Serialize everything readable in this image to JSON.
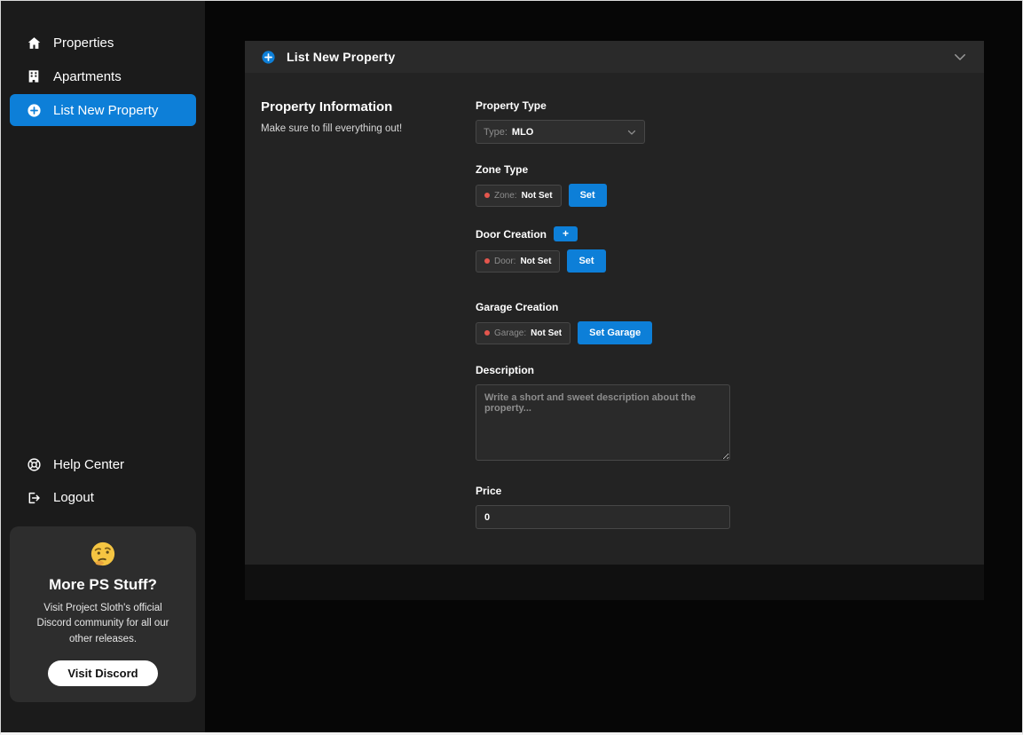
{
  "sidebar": {
    "nav": [
      {
        "label": "Properties",
        "icon": "home-icon",
        "active": false
      },
      {
        "label": "Apartments",
        "icon": "apartments-icon",
        "active": false
      },
      {
        "label": "List New Property",
        "icon": "plus-circle-icon",
        "active": true
      }
    ],
    "bottom_nav": [
      {
        "label": "Help Center",
        "icon": "help-icon"
      },
      {
        "label": "Logout",
        "icon": "logout-icon"
      }
    ],
    "promo": {
      "emoji_icon": "thinking-face",
      "title": "More PS Stuff?",
      "body": "Visit Project Sloth's official Discord community for all our other releases.",
      "button_label": "Visit Discord"
    }
  },
  "panel": {
    "header": {
      "title": "List New Property",
      "leading_icon": "plus-circle",
      "collapse_icon": "chevron-down"
    },
    "info": {
      "title": "Property Information",
      "subtitle": "Make sure to fill everything out!"
    },
    "form": {
      "property_type": {
        "label": "Property Type",
        "prefix": "Type:",
        "value": "MLO"
      },
      "zone": {
        "label": "Zone Type",
        "status_prefix": "Zone:",
        "status_value": "Not Set",
        "set_button": "Set"
      },
      "door": {
        "label": "Door Creation",
        "add_button": "+",
        "status_prefix": "Door:",
        "status_value": "Not Set",
        "set_button": "Set"
      },
      "garage": {
        "label": "Garage Creation",
        "status_prefix": "Garage:",
        "status_value": "Not Set",
        "set_button": "Set Garage"
      },
      "description": {
        "label": "Description",
        "placeholder": "Write a short and sweet description about the property..."
      },
      "price": {
        "label": "Price",
        "value": "0"
      }
    }
  },
  "colors": {
    "accent": "#0d7fd8",
    "danger": "#e4564d",
    "sidebar_bg": "#1b1b1b",
    "panel_bg": "#232323"
  }
}
